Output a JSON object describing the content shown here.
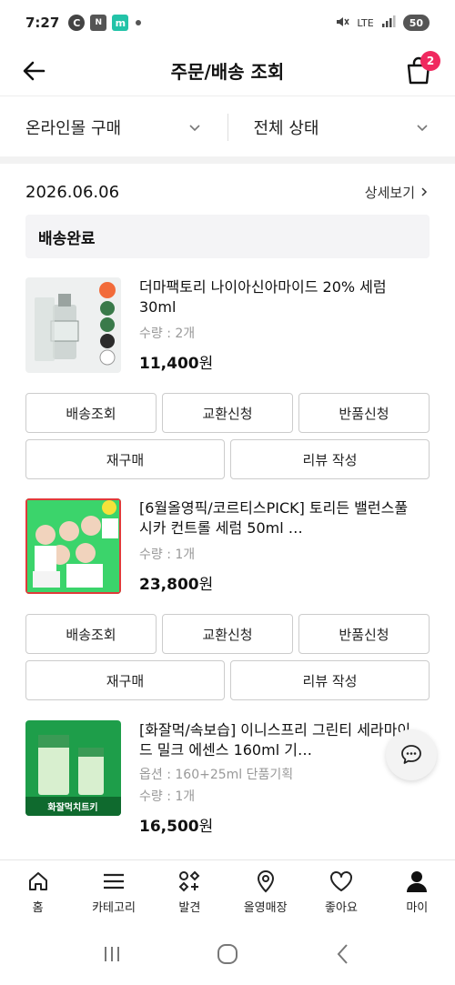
{
  "status_bar": {
    "time": "7:27",
    "icons": [
      "c-icon",
      "news-icon",
      "m-icon"
    ],
    "network": "LTE",
    "battery": "50"
  },
  "header": {
    "title": "주문/배송 조회",
    "cart_count": "2"
  },
  "filters": [
    {
      "label": "온라인몰 구매"
    },
    {
      "label": "전체 상태"
    }
  ],
  "order": {
    "date": "2026.06.06",
    "detail_link": "상세보기",
    "status": "배송완료",
    "items": [
      {
        "name": "더마팩토리 나이아신아마이드 20% 세럼 30ml",
        "meta": "수량 : 2개",
        "price": "11,400",
        "currency": "원",
        "actions": [
          "배송조회",
          "교환신청",
          "반품신청",
          "재구매",
          "리뷰 작성"
        ]
      },
      {
        "name": "[6월올영픽/코르티스PICK] 토리든 밸런스풀 시카 컨트롤 세럼 50ml …",
        "meta": "수량 : 1개",
        "price": "23,800",
        "currency": "원",
        "actions": [
          "배송조회",
          "교환신청",
          "반품신청",
          "재구매",
          "리뷰 작성"
        ]
      },
      {
        "name": "[화잘먹/속보습] 이니스프리 그린티 세라마이드 밀크 에센스 160ml 기…",
        "option": "옵션 : 160+25ml 단품기획",
        "meta": "수량 : 1개",
        "price": "16,500",
        "currency": "원",
        "thumb_text": "화잘먹치트키"
      }
    ]
  },
  "bottom_nav": [
    {
      "label": "홈",
      "icon": "home-icon"
    },
    {
      "label": "카테고리",
      "icon": "menu-icon"
    },
    {
      "label": "발견",
      "icon": "discover-icon"
    },
    {
      "label": "올영매장",
      "icon": "location-pin-icon"
    },
    {
      "label": "좋아요",
      "icon": "heart-icon"
    },
    {
      "label": "마이",
      "icon": "person-icon"
    }
  ],
  "colors": {
    "accent": "#f0295f",
    "status_bg": "#f4f4f6"
  }
}
